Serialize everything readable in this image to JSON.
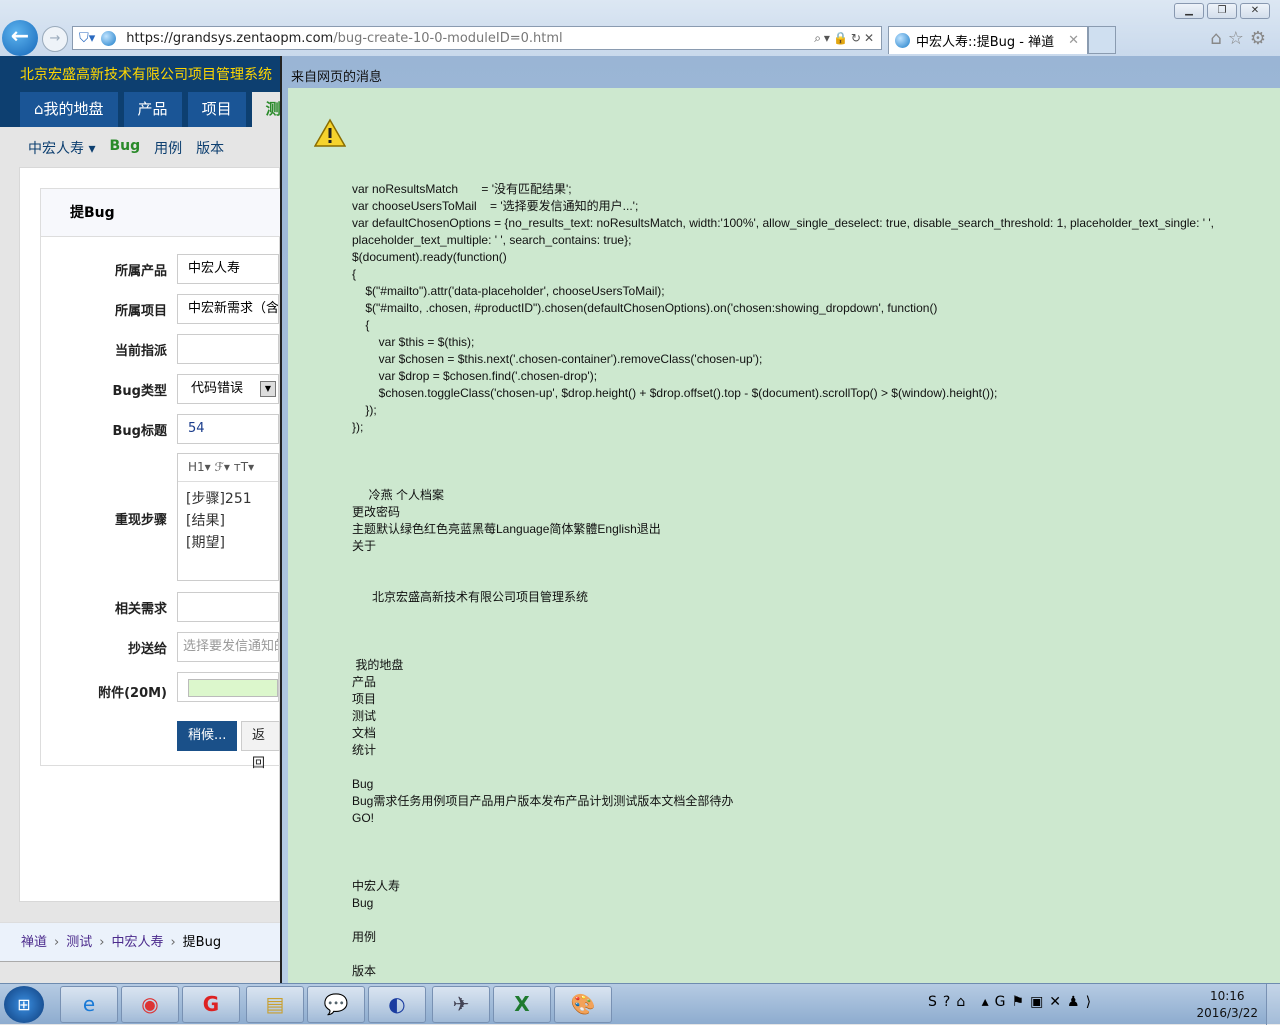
{
  "browser": {
    "url_host": "https://grandsys.zentaopm.com",
    "url_path": "/bug-create-10-0-moduleID=0.html",
    "tab_title": "中宏人寿::提Bug - 禅道"
  },
  "site": {
    "title": "北京宏盛高新技术有限公司项目管理系统",
    "nav": [
      "我的地盘",
      "产品",
      "项目",
      "测"
    ],
    "subnav": {
      "product": "中宏人寿",
      "bug": "Bug",
      "case": "用例",
      "build": "版本"
    }
  },
  "form": {
    "heading": "提Bug",
    "fields": {
      "product_label": "所属产品",
      "product_value": "中宏人寿",
      "project_label": "所属项目",
      "project_value": "中宏新需求（含",
      "assign_label": "当前指派",
      "type_label": "Bug类型",
      "type_value": "代码错误",
      "title_label": "Bug标题",
      "title_value": "54",
      "steps_label": "重现步骤",
      "steps": [
        "[步骤]251",
        "[结果]",
        "[期望]"
      ],
      "editor_toolbar": "H1▾  ℱ▾  ᴛT▾",
      "story_label": "相关需求",
      "mailto_label": "抄送给",
      "mailto_placeholder": "选择要发信通知的",
      "files_label": "附件(20M)"
    },
    "save": "稍候...",
    "back": "返回"
  },
  "breadcrumb": [
    "禅道",
    "测试",
    "中宏人寿",
    "提Bug"
  ],
  "dialog": {
    "title": "来自网页的消息",
    "message": "var noResultsMatch       = '没有匹配结果';\nvar chooseUsersToMail    = '选择要发信通知的用户...';\nvar defaultChosenOptions = {no_results_text: noResultsMatch, width:'100%', allow_single_deselect: true, disable_search_threshold: 1, placeholder_text_single: ' ',\nplaceholder_text_multiple: ' ', search_contains: true};\n$(document).ready(function()\n{\n    $(\"#mailto\").attr('data-placeholder', chooseUsersToMail);\n    $(\"#mailto, .chosen, #productID\").chosen(defaultChosenOptions).on('chosen:showing_dropdown', function()\n    {\n        var $this = $(this);\n        var $chosen = $this.next('.chosen-container').removeClass('chosen-up');\n        var $drop = $chosen.find('.chosen-drop');\n        $chosen.toggleClass('chosen-up', $drop.height() + $drop.offset().top - $(document).scrollTop() > $(window).height());\n    });\n});\n\n\n\n     冷燕 个人档案\n更改密码\n主题默认绿色红色亮蓝黑莓Language简体繁體English退出\n关于\n\n\n      北京宏盛高新技术有限公司项目管理系统\n\n\n\n 我的地盘\n产品\n项目\n测试\n文档\n统计\n\nBug\nBug需求任务用例项目产品用户版本发布产品计划测试版本文档全部待办\nGO!\n\n\n\n中宏人寿\nBug\n\n用例\n\n版本"
  },
  "taskbar": {
    "time": "10:16",
    "date": "2016/3/22"
  }
}
